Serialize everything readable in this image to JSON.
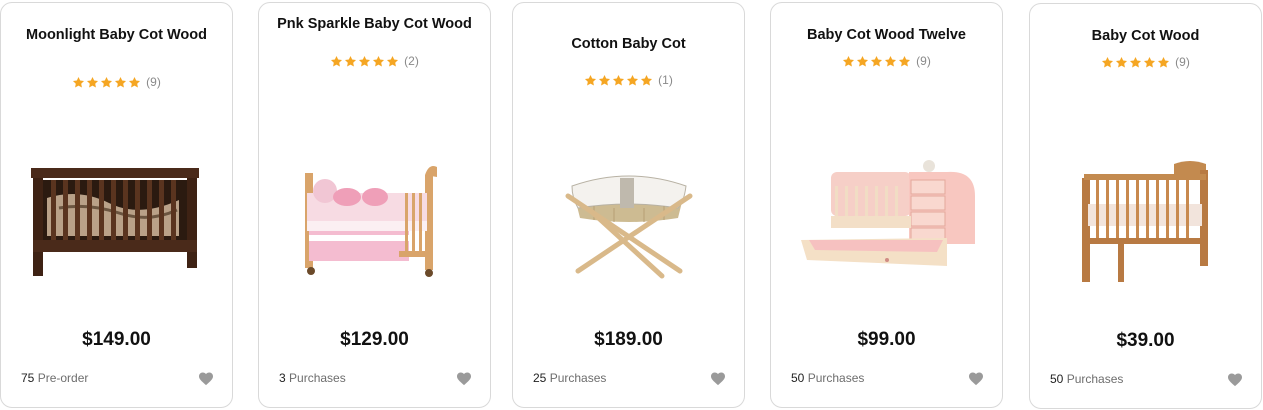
{
  "colors": {
    "star": "#f5a623",
    "heart": "#9a9a9a",
    "border": "#d9d9d9"
  },
  "icons": {
    "star": "star-icon",
    "heart": "heart-icon"
  },
  "products": [
    {
      "title": "Moonlight Baby Cot Wood",
      "rating": 5,
      "rating_count": "(9)",
      "price": "$149.00",
      "meta_number": "75",
      "meta_label": "Pre-order"
    },
    {
      "title": "Pnk Sparkle Baby Cot Wood",
      "rating": 5,
      "rating_count": "(2)",
      "price": "$129.00",
      "meta_number": "3",
      "meta_label": "Purchases"
    },
    {
      "title": "Cotton Baby Cot",
      "rating": 5,
      "rating_count": "(1)",
      "price": "$189.00",
      "meta_number": "25",
      "meta_label": "Purchases"
    },
    {
      "title": "Baby Cot Wood Twelve",
      "rating": 5,
      "rating_count": "(9)",
      "price": "$99.00",
      "meta_number": "50",
      "meta_label": "Purchases"
    },
    {
      "title": "Baby Cot Wood",
      "rating": 5,
      "rating_count": "(9)",
      "price": "$39.00",
      "meta_number": "50",
      "meta_label": "Purchases"
    }
  ]
}
